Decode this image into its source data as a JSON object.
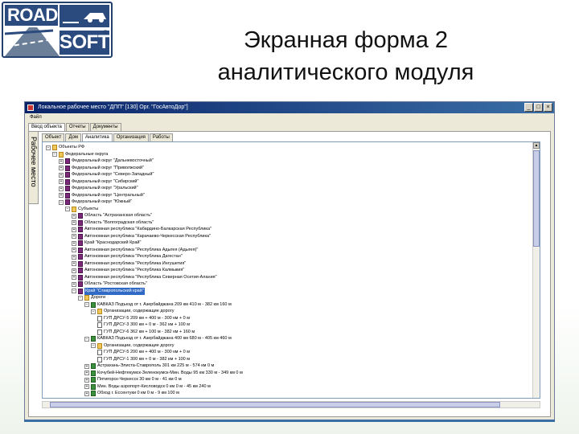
{
  "logo": {
    "word1": "ROAD",
    "word2": "SOFT",
    "registered": "®"
  },
  "slide": {
    "title_line1": "Экранная форма 2",
    "title_line2": "аналитического модуля"
  },
  "window": {
    "title": "Локальное рабочее место \"ДПП\" [130] Орг. \"ГосАвтоДор\"]",
    "menu": "Файл",
    "buttons": {
      "minimize": "_",
      "maximize": "□",
      "close": "×"
    },
    "top_tabs": [
      "Ввод объекта",
      "Отчеты",
      "Документы"
    ],
    "vertical_tab_label": "Рабочее место",
    "inner_tabs": [
      "Объект",
      "Дом",
      "Аналитика",
      "Организация",
      "Работы"
    ],
    "active_inner_tab": 2
  },
  "tree": [
    {
      "level": 0,
      "exp": "−",
      "icon": "folder",
      "label": "Объекты РФ"
    },
    {
      "level": 1,
      "exp": "−",
      "icon": "folder",
      "label": "Федеральные округа"
    },
    {
      "level": 2,
      "exp": "+",
      "icon": "book",
      "label": "Федеральный округ \"Дальневосточный\""
    },
    {
      "level": 2,
      "exp": "+",
      "icon": "book",
      "label": "Федеральный округ \"Приволжский\""
    },
    {
      "level": 2,
      "exp": "+",
      "icon": "book",
      "label": "Федеральный округ \"Северо-Западный\""
    },
    {
      "level": 2,
      "exp": "+",
      "icon": "book",
      "label": "Федеральный округ \"Сибирский\""
    },
    {
      "level": 2,
      "exp": "+",
      "icon": "book",
      "label": "Федеральный округ \"Уральский\""
    },
    {
      "level": 2,
      "exp": "+",
      "icon": "book",
      "label": "Федеральный округ \"Центральный\""
    },
    {
      "level": 2,
      "exp": "−",
      "icon": "book",
      "label": "Федеральный округ \"Южный\""
    },
    {
      "level": 3,
      "exp": "−",
      "icon": "folder",
      "label": "Субъекты"
    },
    {
      "level": 4,
      "exp": "+",
      "icon": "book",
      "label": "Область \"Астраханская область\""
    },
    {
      "level": 4,
      "exp": "+",
      "icon": "book",
      "label": "Область \"Волгоградская область\""
    },
    {
      "level": 4,
      "exp": "+",
      "icon": "book",
      "label": "Автономная республика \"Кабардино-Балкарская Республика\""
    },
    {
      "level": 4,
      "exp": "+",
      "icon": "book",
      "label": "Автономная республика \"Карачаево-Черкесская Республика\""
    },
    {
      "level": 4,
      "exp": "+",
      "icon": "book",
      "label": "Край \"Краснодарский Край\""
    },
    {
      "level": 4,
      "exp": "+",
      "icon": "book",
      "label": "Автономная республика \"Республика Адыгея (Адыгея)\""
    },
    {
      "level": 4,
      "exp": "+",
      "icon": "book",
      "label": "Автономная республика \"Республика Дагестан\""
    },
    {
      "level": 4,
      "exp": "+",
      "icon": "book",
      "label": "Автономная республика \"Республика Ингушетия\""
    },
    {
      "level": 4,
      "exp": "+",
      "icon": "book",
      "label": "Автономная республика \"Республика Калмыкия\""
    },
    {
      "level": 4,
      "exp": "+",
      "icon": "book",
      "label": "Автономная республика \"Республика Северная Осетия-Алания\""
    },
    {
      "level": 4,
      "exp": "+",
      "icon": "book",
      "label": "Область \"Ростовская область\""
    },
    {
      "level": 4,
      "exp": "−",
      "icon": "book",
      "label": "Край \"Ставропольский край\"",
      "selected": true
    },
    {
      "level": 5,
      "exp": "−",
      "icon": "folder",
      "label": "Дороги"
    },
    {
      "level": 6,
      "exp": "−",
      "icon": "road",
      "label": "КАВКАЗ Подъезд от г. Азербайджана 209 км 410 м - 382 км 160 м"
    },
    {
      "level": 7,
      "exp": "−",
      "icon": "folder",
      "label": "Организации, содержащие дорогу"
    },
    {
      "level": 8,
      "exp": "",
      "icon": "doc",
      "label": "ГУП ДРСУ-5 209 км + 400 м - 300 км + 0 м"
    },
    {
      "level": 8,
      "exp": "",
      "icon": "doc",
      "label": "ГУП ДРСУ-3 300 км + 0 м - 362 км + 100 м"
    },
    {
      "level": 8,
      "exp": "",
      "icon": "doc",
      "label": "ГУП ДРСУ-6 362 км + 100 м - 382 км + 160 м"
    },
    {
      "level": 6,
      "exp": "−",
      "icon": "road",
      "label": "КАВКАЗ Подъезд от г. Азербайджана 400 км 680 м - 405 км 460 м"
    },
    {
      "level": 7,
      "exp": "−",
      "icon": "folder",
      "label": "Организации, содержащие дорогу"
    },
    {
      "level": 8,
      "exp": "",
      "icon": "doc",
      "label": "ГУП ДРСУ-5 200 км + 400 м - 300 км + 0 м"
    },
    {
      "level": 8,
      "exp": "",
      "icon": "doc",
      "label": "ГУП ДРСУ-1 300 км + 0 м - 382 км + 100 м"
    },
    {
      "level": 6,
      "exp": "+",
      "icon": "road",
      "label": "Астрахань-Элиста-Ставрополь 301 км 225 м - 574 км 0 м"
    },
    {
      "level": 6,
      "exp": "+",
      "icon": "road",
      "label": "Кочубей-Нефтекумск-Зеленокумск-Мин. Воды 95 км 330 м - 349 км 0 м"
    },
    {
      "level": 6,
      "exp": "+",
      "icon": "road",
      "label": "Пятигорск-Черкесск 30 км 0 м - 41 км 0 м"
    },
    {
      "level": 6,
      "exp": "+",
      "icon": "road",
      "label": "Мин. Воды аэропорт-Кисловодск 0 км 0 м - 45 км 240 м"
    },
    {
      "level": 6,
      "exp": "+",
      "icon": "road",
      "label": "Обход г. Ессентуки 0 км 0 м - 9 км 100 м"
    }
  ]
}
